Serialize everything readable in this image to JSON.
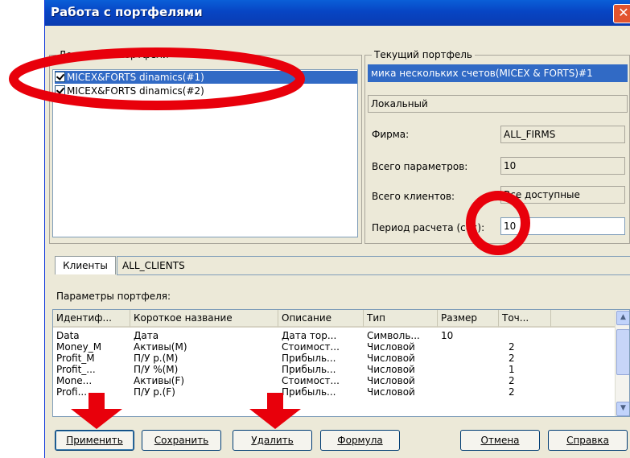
{
  "window": {
    "title": "Работа с портфелями",
    "close_glyph": "✕"
  },
  "available": {
    "legend": "Доступные портфели",
    "items": [
      {
        "label": "MICEX&FORTS dinamics(#1)",
        "checked": true,
        "selected": true
      },
      {
        "label": "MICEX&FORTS dinamics(#2)",
        "checked": true,
        "selected": false
      }
    ]
  },
  "current": {
    "legend": "Текущий портфель",
    "name": "мика нескольких счетов(MICEX & FORTS)#1",
    "type": "Локальный",
    "firm_label": "Фирма:",
    "firm_value": "ALL_FIRMS",
    "params_label": "Всего параметров:",
    "params_value": "10",
    "clients_label": "Всего клиентов:",
    "clients_value": "Все доступные",
    "period_label": "Период расчета (сек):",
    "period_value": "10"
  },
  "tabs": {
    "clients_tab": "Клиенты",
    "clients_value": "ALL_CLIENTS"
  },
  "params_heading": "Параметры портфеля:",
  "table": {
    "columns": [
      "Идентиф...",
      "Короткое название",
      "Описание",
      "Тип",
      "Размер",
      "Точ..."
    ],
    "rows": [
      [
        "Data",
        "Дата",
        "Дата тор...",
        "Символь...",
        "10",
        ""
      ],
      [
        "Money_M",
        "Активы(M)",
        "Стоимост...",
        "Числовой",
        "",
        "2"
      ],
      [
        "Profit_M",
        "П/У р.(M)",
        "Прибыль...",
        "Числовой",
        "",
        "2"
      ],
      [
        "Profit_...",
        "П/У %(M)",
        "Прибыль...",
        "Числовой",
        "",
        "1"
      ],
      [
        "Mone...",
        "Активы(F)",
        "Стоимост...",
        "Числовой",
        "",
        "2"
      ],
      [
        "Profi...",
        "П/У р.(F)",
        "Прибыль...",
        "Числовой",
        "",
        "2"
      ]
    ]
  },
  "buttons": {
    "apply": "Применить",
    "save": "Сохранить",
    "delete": "Удалить",
    "formula": "Формула",
    "cancel": "Отмена",
    "help": "Справка"
  },
  "colors": {
    "annotation_red": "#e8000b",
    "selection_blue": "#316ac5",
    "title_blue": "#0a5fd8"
  }
}
